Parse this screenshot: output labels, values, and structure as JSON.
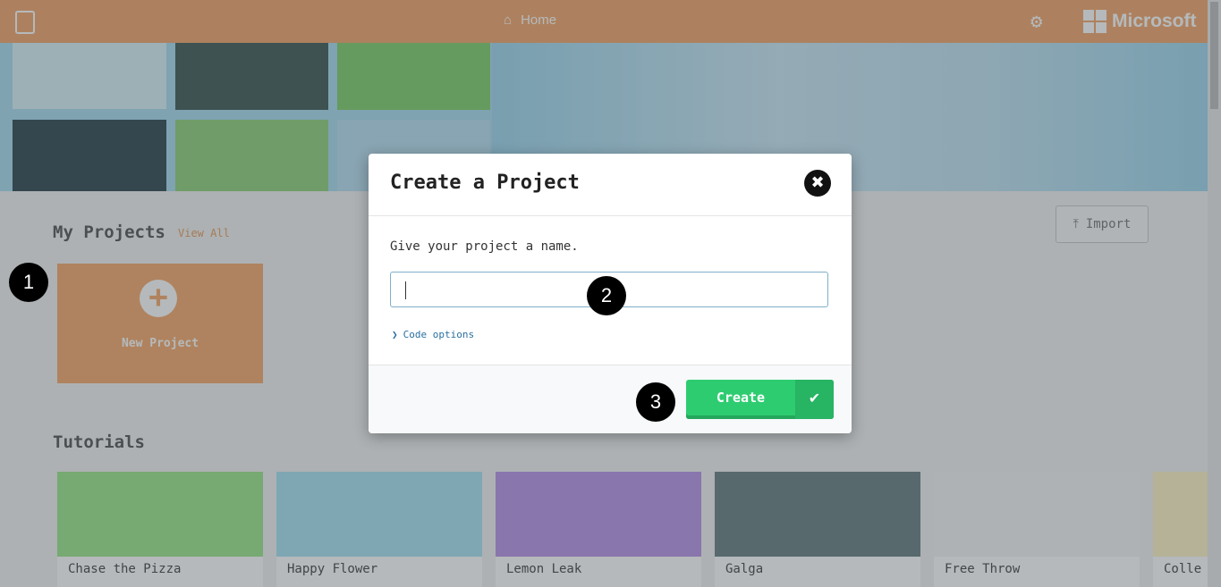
{
  "header": {
    "home_label": "Home",
    "brand": "Microsoft",
    "home_icon": "home-icon",
    "settings_icon": "gear-icon"
  },
  "colors": {
    "accent": "#f3a56b",
    "create_green": "#2ecc71",
    "link_blue": "#2a6fa0"
  },
  "projects": {
    "title": "My Projects",
    "view_all": "View All",
    "import_label": "Import",
    "new_project_label": "New Project"
  },
  "tutorials": {
    "title": "Tutorials",
    "items": [
      {
        "label": "Chase the Pizza",
        "color": "#9be58a"
      },
      {
        "label": "Happy Flower",
        "color": "#a9e2f2"
      },
      {
        "label": "Lemon Leak",
        "color": "#b894e8"
      },
      {
        "label": "Galga",
        "color": "#6a7f83"
      },
      {
        "label": "Free Throw",
        "color": "#f4f4f4"
      },
      {
        "label": "Colle",
        "color": "#fff4c7"
      }
    ]
  },
  "markers": [
    "1",
    "2",
    "3"
  ],
  "dialog": {
    "title": "Create a Project",
    "prompt": "Give your project a name.",
    "name_value": "",
    "code_options": "Code options",
    "create_label": "Create"
  }
}
